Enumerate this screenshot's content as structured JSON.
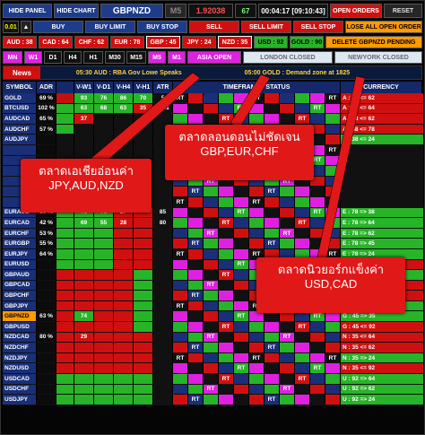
{
  "toolbar": {
    "hide_panel": "HIDE PANEL",
    "hide_chart": "HIDE CHART",
    "symbol": "GBPNZD",
    "timeframe": "M5",
    "price": "1.92038",
    "spread": "67",
    "time": "00:04:17 [09:10:43]",
    "open_orders": "OPEN ORDERS",
    "reset": "RESET",
    "lot": "0.01",
    "lot_up": "▲",
    "buy": "BUY",
    "buy_limit": "BUY LIMIT",
    "buy_stop": "BUY STOP",
    "sell": "SELL",
    "sell_limit": "SELL LIMIT",
    "sell_stop": "SELL STOP",
    "close_all_open": "CLOSE ALL OPEN ORDERS",
    "delete_pending": "DELETE GBPNZD PENDING"
  },
  "strength": {
    "aud": "AUD : 38",
    "cad": "CAD : 64",
    "chf": "CHF : 62",
    "eur": "EUR : 78",
    "gbp": "GBP : 45",
    "jpy": "JPY : 24",
    "nzd": "NZD : 35",
    "usd": "USD : 92",
    "gold": "GOLD : 90"
  },
  "timeframes": [
    "MN",
    "W1",
    "D1",
    "H4",
    "H1",
    "M30",
    "M15",
    "M5",
    "M1"
  ],
  "sessions": {
    "asia": "ASIA OPEN",
    "london": "LONDON CLOSED",
    "newyork": "NEWYORK CLOSED"
  },
  "news": {
    "label": "News",
    "item1": "05:30 AUD : RBA Gov Lowe Speaks",
    "item2": "05:00 GOLD : Demand zone at 1825"
  },
  "table": {
    "headers": [
      "SYMBOL",
      "ADR",
      "V-W1",
      "V-D1",
      "V-H4",
      "V-H1",
      "ATR",
      "TIMEFRAME - STATUS",
      "CURRENCY"
    ],
    "rows": [
      {
        "symbol": "GOLD",
        "adr": "69 %",
        "v": [
          "93",
          "76",
          "86",
          "70",
          "5"
        ],
        "vc": [
          "#28b428",
          "#28b428",
          "#28b428",
          "#28b428",
          "#111"
        ],
        "bar": "#c01010"
      },
      {
        "symbol": "BTCUSD",
        "adr": "102 %",
        "v": [
          "63",
          "68",
          "63",
          "35",
          "3081"
        ],
        "vc": [
          "#28b428",
          "#28b428",
          "#28b428",
          "#d01010",
          "#111"
        ],
        "bar": "#28b428"
      },
      {
        "symbol": "AUDCAD",
        "adr": "65 %",
        "v": [
          "37",
          "",
          "",
          "",
          ""
        ],
        "vc": [
          "#d01010",
          "#111",
          "#111",
          "#111",
          "#111"
        ],
        "bar": "#28b428"
      },
      {
        "symbol": "AUDCHF",
        "adr": "57 %",
        "v": [
          "",
          "",
          "",
          "",
          ""
        ],
        "vc": [
          "#111",
          "#111",
          "#111",
          "#111",
          "#111"
        ],
        "bar": "#28b428"
      },
      {
        "symbol": "AUDJPY",
        "adr": "",
        "v": [
          "",
          "",
          "",
          "",
          ""
        ],
        "vc": [
          "#111",
          "#111",
          "#111",
          "#111",
          "#111"
        ],
        "bar": "#111"
      },
      {
        "symbol": "",
        "adr": "",
        "v": [
          "",
          "",
          "",
          "",
          ""
        ],
        "vc": [
          "#111",
          "#111",
          "#111",
          "#111",
          "#111"
        ],
        "bar": "#111"
      },
      {
        "symbol": "",
        "adr": "",
        "v": [
          "",
          "",
          "",
          "",
          ""
        ],
        "vc": [
          "#111",
          "#111",
          "#111",
          "#111",
          "#111"
        ],
        "bar": "#111"
      },
      {
        "symbol": "",
        "adr": "",
        "v": [
          "",
          "",
          "",
          "",
          ""
        ],
        "vc": [
          "#111",
          "#111",
          "#111",
          "#111",
          "#111"
        ],
        "bar": "#111"
      },
      {
        "symbol": "",
        "adr": "",
        "v": [
          "",
          "",
          "",
          "",
          ""
        ],
        "vc": [
          "#111",
          "#111",
          "#111",
          "#111",
          "#111"
        ],
        "bar": "#111"
      },
      {
        "symbol": "",
        "adr": "",
        "v": [
          "",
          "",
          "",
          "",
          ""
        ],
        "vc": [
          "#111",
          "#111",
          "#111",
          "#111",
          "#111"
        ],
        "bar": "#111"
      },
      {
        "symbol": "",
        "adr": "",
        "v": [
          "",
          "",
          "",
          "",
          ""
        ],
        "vc": [
          "#111",
          "#111",
          "#111",
          "#111",
          "#111"
        ],
        "bar": "#111"
      },
      {
        "symbol": "EURAUD",
        "adr": "60 %",
        "v": [
          "73",
          "71",
          "27",
          "",
          "85"
        ],
        "vc": [
          "#28b428",
          "#28b428",
          "#d01010",
          "#d01010",
          "#111"
        ],
        "bar": "#28b428"
      },
      {
        "symbol": "EURCAD",
        "adr": "42 %",
        "v": [
          "69",
          "55",
          "28",
          "",
          "80"
        ],
        "vc": [
          "#28b428",
          "#28b428",
          "#d01010",
          "#d01010",
          "#111"
        ],
        "bar": "#28b428"
      },
      {
        "symbol": "EURCHF",
        "adr": "53 %",
        "v": [
          "",
          "",
          "",
          "",
          ""
        ],
        "vc": [
          "#28b428",
          "#28b428",
          "#d01010",
          "#d01010",
          "#111"
        ],
        "bar": "#28b428"
      },
      {
        "symbol": "EURGBP",
        "adr": "55 %",
        "v": [
          "",
          "",
          "",
          "",
          ""
        ],
        "vc": [
          "#28b428",
          "#28b428",
          "#d01010",
          "#d01010",
          "#111"
        ],
        "bar": "#28b428"
      },
      {
        "symbol": "EURJPY",
        "adr": "64 %",
        "v": [
          "",
          "",
          "",
          "",
          ""
        ],
        "vc": [
          "#28b428",
          "#28b428",
          "#d01010",
          "#d01010",
          "#111"
        ],
        "bar": "#28b428"
      },
      {
        "symbol": "EURUSD",
        "adr": "",
        "v": [
          "",
          "",
          "",
          "",
          ""
        ],
        "vc": [
          "#28b428",
          "#28b428",
          "#d01010",
          "#d01010",
          "#111"
        ],
        "bar": "#28b428"
      },
      {
        "symbol": "GBPAUD",
        "adr": "",
        "v": [
          "",
          "",
          "",
          "",
          ""
        ],
        "vc": [
          "#d01010",
          "#d01010",
          "#d01010",
          "#28b428",
          "#111"
        ],
        "bar": "#d01010"
      },
      {
        "symbol": "GBPCAD",
        "adr": "",
        "v": [
          "",
          "",
          "",
          "",
          ""
        ],
        "vc": [
          "#d01010",
          "#d01010",
          "#d01010",
          "#28b428",
          "#111"
        ],
        "bar": "#d01010"
      },
      {
        "symbol": "GBPCHF",
        "adr": "",
        "v": [
          "",
          "",
          "",
          "",
          ""
        ],
        "vc": [
          "#d01010",
          "#d01010",
          "#d01010",
          "#28b428",
          "#111"
        ],
        "bar": "#d01010"
      },
      {
        "symbol": "GBPJPY",
        "adr": "",
        "v": [
          "",
          "",
          "",
          "",
          ""
        ],
        "vc": [
          "#d01010",
          "#d01010",
          "#d01010",
          "#28b428",
          "#111"
        ],
        "bar": "#d01010"
      },
      {
        "symbol": "GBPNZD",
        "adr": "63 %",
        "v": [
          "74",
          "",
          "",
          "",
          ""
        ],
        "vc": [
          "#28b428",
          "#d01010",
          "#d01010",
          "#28b428",
          "#111"
        ],
        "bar": "#d01010",
        "selected": true
      },
      {
        "symbol": "GBPUSD",
        "adr": "",
        "v": [
          "",
          "",
          "",
          "",
          ""
        ],
        "vc": [
          "#d01010",
          "#d01010",
          "#d01010",
          "#28b428",
          "#111"
        ],
        "bar": "#d01010"
      },
      {
        "symbol": "NZDCAD",
        "adr": "80 %",
        "v": [
          "29",
          "",
          "",
          "",
          ""
        ],
        "vc": [
          "#d01010",
          "#d01010",
          "#d01010",
          "#d01010",
          "#111"
        ],
        "bar": "#d01010"
      },
      {
        "symbol": "NZDCHF",
        "adr": "",
        "v": [
          "",
          "",
          "",
          "",
          ""
        ],
        "vc": [
          "#d01010",
          "#d01010",
          "#d01010",
          "#d01010",
          "#111"
        ],
        "bar": "#d01010"
      },
      {
        "symbol": "NZDJPY",
        "adr": "",
        "v": [
          "",
          "",
          "",
          "",
          ""
        ],
        "vc": [
          "#d01010",
          "#d01010",
          "#d01010",
          "#d01010",
          "#111"
        ],
        "bar": "#d01010"
      },
      {
        "symbol": "NZDUSD",
        "adr": "",
        "v": [
          "",
          "",
          "",
          "",
          ""
        ],
        "vc": [
          "#d01010",
          "#d01010",
          "#d01010",
          "#d01010",
          "#111"
        ],
        "bar": "#d01010"
      },
      {
        "symbol": "USDCAD",
        "adr": "",
        "v": [
          "",
          "",
          "",
          "",
          ""
        ],
        "vc": [
          "#28b428",
          "#28b428",
          "#28b428",
          "#28b428",
          "#111"
        ],
        "bar": "#28b428"
      },
      {
        "symbol": "USDCHF",
        "adr": "",
        "v": [
          "",
          "",
          "",
          "",
          ""
        ],
        "vc": [
          "#28b428",
          "#28b428",
          "#28b428",
          "#28b428",
          "#111"
        ],
        "bar": "#28b428"
      },
      {
        "symbol": "USDJPY",
        "adr": "",
        "v": [
          "",
          "",
          "",
          "",
          ""
        ],
        "vc": [
          "#28b428",
          "#28b428",
          "#28b428",
          "#28b428",
          "#111"
        ],
        "bar": "#28b428"
      }
    ],
    "currency_col": [
      "A : 38 <= 62",
      "A : 38 <= 64",
      "A : 38 <= 62",
      "A : 38 <= 78",
      "A : 38 <= 24",
      "",
      "",
      "",
      "",
      "",
      "",
      "E : 78 => 38",
      "E : 78 => 64",
      "E : 78 => 62",
      "E : 78 => 45",
      "E : 78 => 24",
      "E : 78 <= 92",
      "G : 45 => 38",
      "G : 45 <= 64",
      "G : 45 <= 62",
      "G : 45 => 24",
      "G : 45 => 35",
      "G : 45 <= 92",
      "N : 35 <= 64",
      "N : 35 <= 62",
      "N : 35 => 24",
      "N : 35 <= 92",
      "U : 92 => 64",
      "U : 92 => 62",
      "U : 92 => 24"
    ],
    "currency_colors": [
      "#d01010",
      "#d01010",
      "#d01010",
      "#d01010",
      "#28b428",
      "#111",
      "#111",
      "#111",
      "#111",
      "#111",
      "#111",
      "#28b428",
      "#28b428",
      "#28b428",
      "#28b428",
      "#28b428",
      "#d01010",
      "#28b428",
      "#d01010",
      "#d01010",
      "#28b428",
      "#28b428",
      "#d01010",
      "#d01010",
      "#d01010",
      "#28b428",
      "#d01010",
      "#28b428",
      "#28b428",
      "#28b428"
    ],
    "tf_labels": [
      "RT",
      "M5",
      "EU",
      "M15",
      "RT",
      "RT",
      "MN1",
      "W1",
      "D1",
      "EU"
    ],
    "tf_palette": [
      "#111",
      "#28b428",
      "#d01010",
      "#e020e0",
      "#1a2f78"
    ]
  },
  "annotations": {
    "asia": {
      "line1": "ตลาดเอเชียอ่อนค่า",
      "line2": "JPY,AUD,NZD"
    },
    "london": {
      "line1": "ตลาดลอนดอนไม่ชัดเจน",
      "line2": "GBP,EUR,CHF"
    },
    "newyork": {
      "line1": "ตลาดนิวยอร์กแข็งค่า",
      "line2": "USD,CAD"
    }
  }
}
